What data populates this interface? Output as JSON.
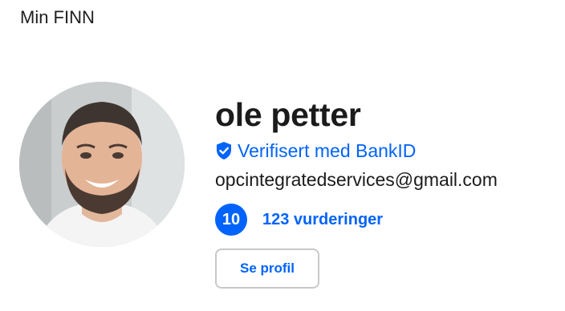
{
  "header": {
    "title": "Min FINN"
  },
  "profile": {
    "avatar_icon": "user-avatar",
    "name": "ole petter",
    "verified_icon": "shield-check-icon",
    "verified_label": "Verifisert med BankID",
    "email": "opcintegratedservices@gmail.com",
    "rating_score": "10",
    "reviews_label": "123 vurderinger",
    "view_profile_label": "Se profil"
  },
  "colors": {
    "accent": "#0063fb",
    "text": "#1b1b1b",
    "button_border": "#c8c8c8"
  }
}
